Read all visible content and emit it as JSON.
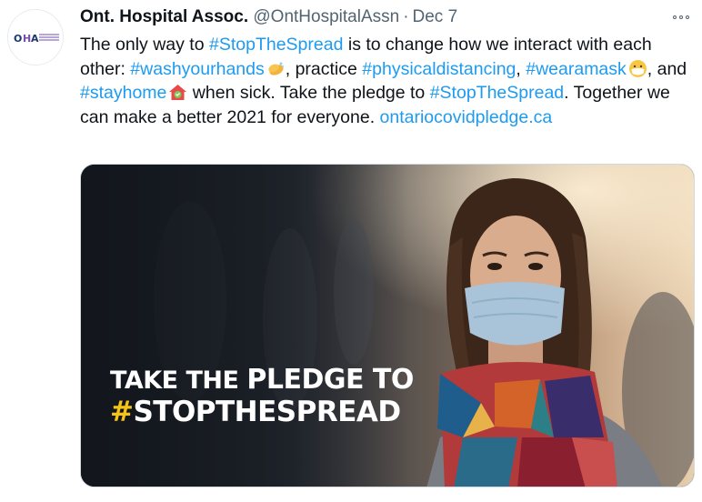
{
  "tweet": {
    "author_name": "Ont. Hospital Assoc.",
    "handle": "@OntHospitalAssn",
    "separator": "·",
    "date": "Dec 7",
    "segments": [
      {
        "t": "text",
        "v": "The only way to "
      },
      {
        "t": "link",
        "v": "#StopTheSpread"
      },
      {
        "t": "text",
        "v": " is to change how we interact with each other:  "
      },
      {
        "t": "link",
        "v": "#washyourhands"
      },
      {
        "t": "emoji",
        "v": "hands-emoji"
      },
      {
        "t": "text",
        "v": ", practice "
      },
      {
        "t": "link",
        "v": "#physicaldistancing"
      },
      {
        "t": "text",
        "v": ", "
      },
      {
        "t": "link",
        "v": "#wearamask"
      },
      {
        "t": "emoji",
        "v": "mask-face-emoji"
      },
      {
        "t": "text",
        "v": ", and "
      },
      {
        "t": "link",
        "v": "#stayhome"
      },
      {
        "t": "emoji",
        "v": "house-emoji"
      },
      {
        "t": "text",
        "v": " when sick. Take the pledge to "
      },
      {
        "t": "link",
        "v": "#StopTheSpread"
      },
      {
        "t": "text",
        "v": ". Together we can make a better 2021 for everyone. "
      },
      {
        "t": "link",
        "v": "ontariocovidpledge.ca"
      }
    ]
  },
  "avatar": {
    "icon": "otha-logo-icon",
    "logo_letters": [
      "O",
      "H",
      "A"
    ]
  },
  "media": {
    "icon": "photo-woman-wearing-mask",
    "overlay_line1_pre": "TAKE THE ",
    "overlay_line1_big": "PLEDGE TO",
    "overlay_line2_hash": "#",
    "overlay_line2": "STOPTHESPREAD"
  },
  "colors": {
    "link": "#1d9bf0",
    "secondary_text": "#536471",
    "overlay_hash": "#f6c416"
  }
}
